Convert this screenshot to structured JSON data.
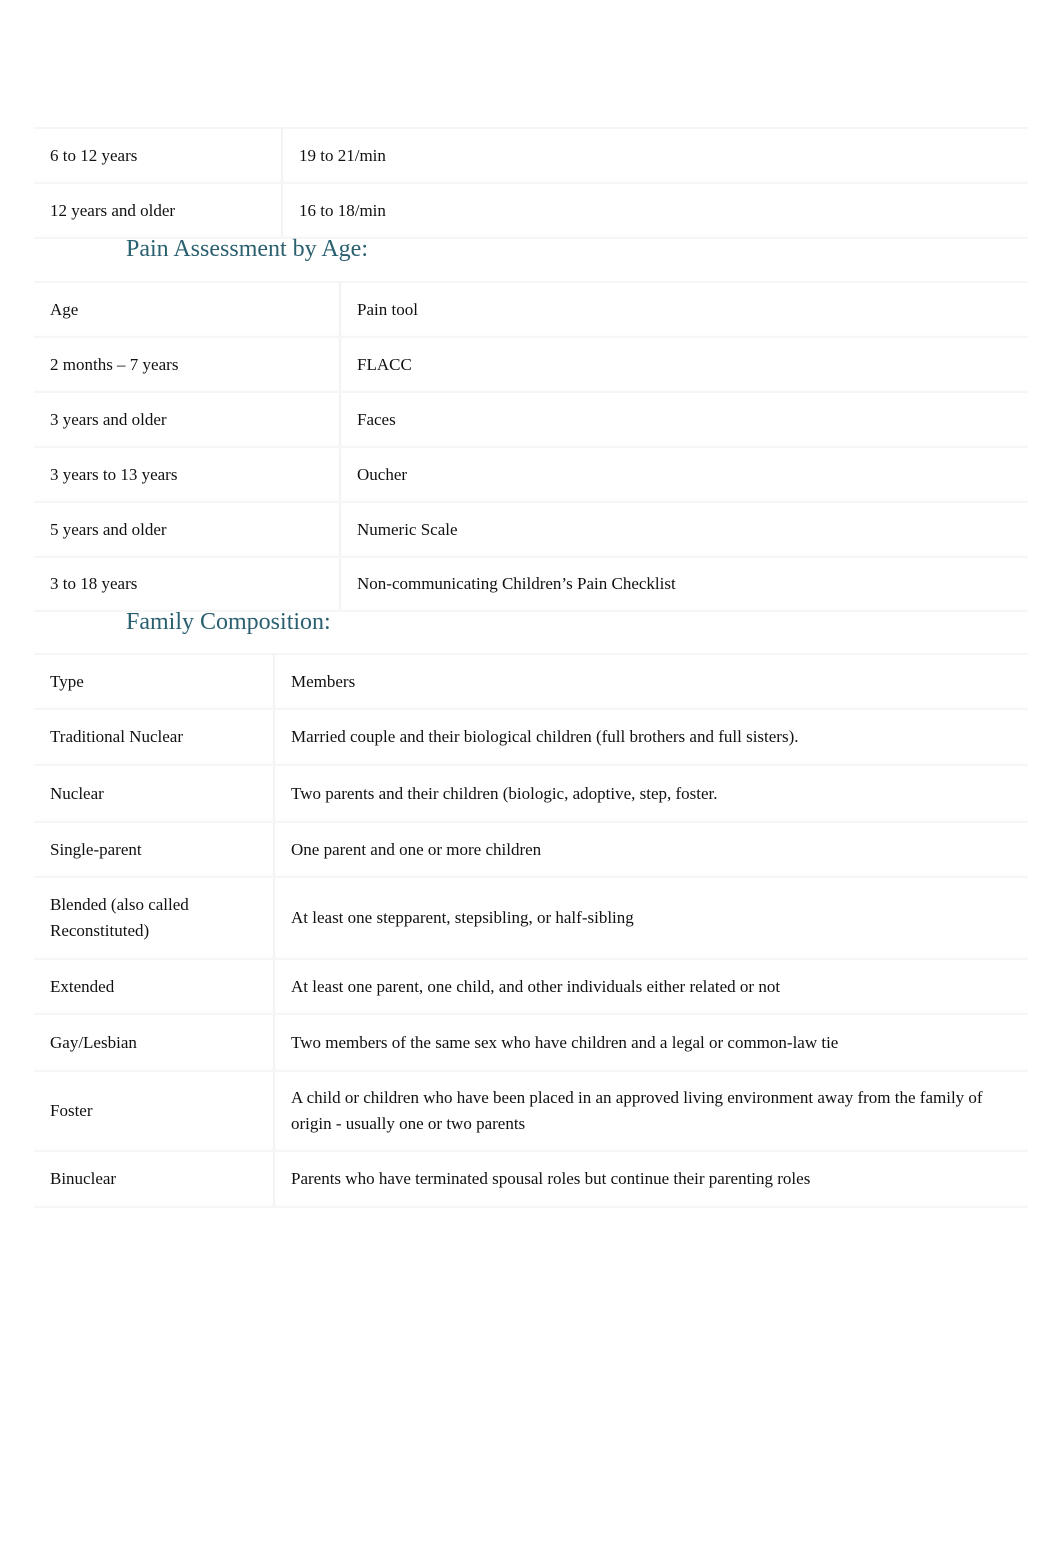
{
  "respiratory_table": {
    "rows": [
      {
        "age": "6 to 12 years",
        "rate": "19 to 21/min"
      },
      {
        "age": "12 years and older",
        "rate": "16 to 18/min"
      }
    ]
  },
  "pain_section": {
    "heading": "Pain Assessment by Age:",
    "header": {
      "age": "Age",
      "tool": "Pain tool"
    },
    "rows": [
      {
        "age": "2 months – 7 years",
        "tool": "FLACC"
      },
      {
        "age": "3 years and older",
        "tool": "Faces"
      },
      {
        "age": "3 years to 13 years",
        "tool": "Oucher"
      },
      {
        "age": "5 years and older",
        "tool": "Numeric Scale"
      },
      {
        "age": "3 to 18 years",
        "tool": "Non-communicating Children’s Pain Checklist"
      }
    ]
  },
  "family_section": {
    "heading": "Family Composition:",
    "header": {
      "type": "Type",
      "members": "Members"
    },
    "rows": [
      {
        "type": "Traditional Nuclear",
        "members": "Married couple and their biological children (full brothers and full sisters)."
      },
      {
        "type": "Nuclear",
        "members": "Two parents and their children (biologic, adoptive, step, foster."
      },
      {
        "type": "Single-parent",
        "members": "One parent and one or more children"
      },
      {
        "type": "Blended (also called Reconstituted)",
        "members": "At least one stepparent, stepsibling, or half-sibling"
      },
      {
        "type": "Extended",
        "members": "At least one parent, one child, and other individuals either related or not"
      },
      {
        "type": "Gay/Lesbian",
        "members": "Two members of the same sex who have children and a legal or common-law tie"
      },
      {
        "type": "Foster",
        "members": "A child or children who have been placed in an approved living environment away from the family of origin - usually one or two parents"
      },
      {
        "type": "Binuclear",
        "members": "Parents who have terminated spousal roles but continue their parenting roles"
      }
    ]
  },
  "colors": {
    "heading": "#2a6070",
    "text": "#111111",
    "border": "#f3f3f3"
  }
}
